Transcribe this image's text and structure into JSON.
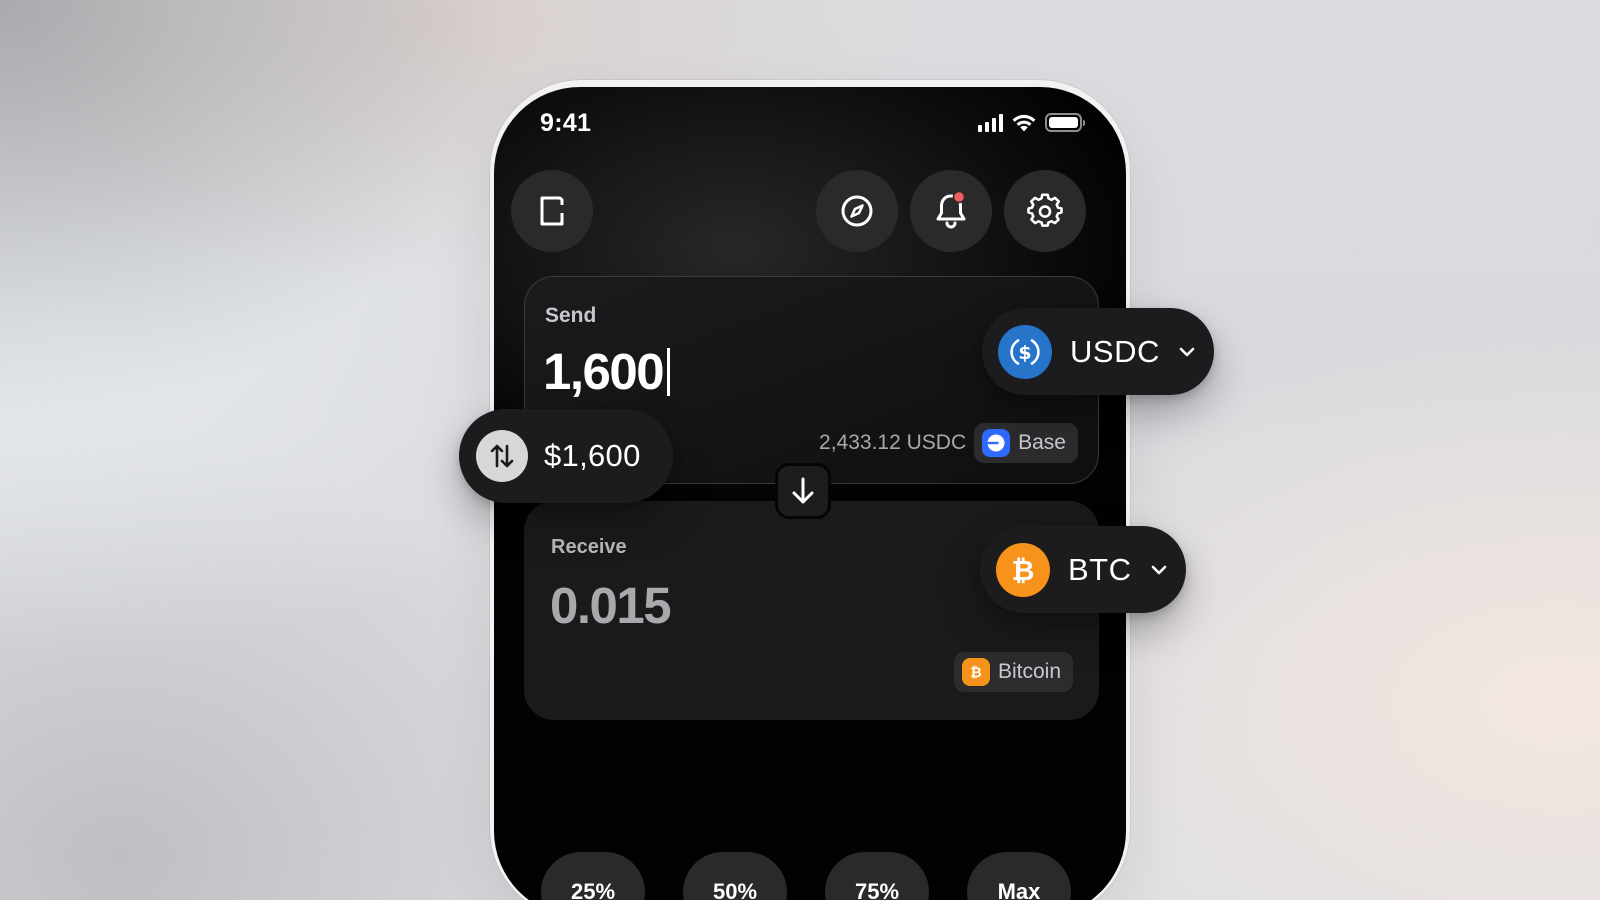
{
  "status_bar": {
    "time": "9:41"
  },
  "header": {
    "left_icon": "wallet-icon",
    "right_icons": [
      "compass-icon",
      "bell-icon",
      "gear-icon"
    ],
    "notification_dot_color": "#f25c5c"
  },
  "send": {
    "label": "Send",
    "amount": "1,600",
    "balance": "2,433.12 USDC",
    "network": "Base",
    "network_color": "#2f6bff",
    "token": "USDC",
    "token_color": "#2775ca"
  },
  "fiat_toggle": {
    "value": "$1,600",
    "icon": "swap-vertical-icon"
  },
  "receive": {
    "label": "Receive",
    "amount": "0.015",
    "network": "Bitcoin",
    "token": "BTC",
    "token_color": "#f7931a"
  },
  "quick_amounts": [
    "25%",
    "50%",
    "75%",
    "Max"
  ]
}
